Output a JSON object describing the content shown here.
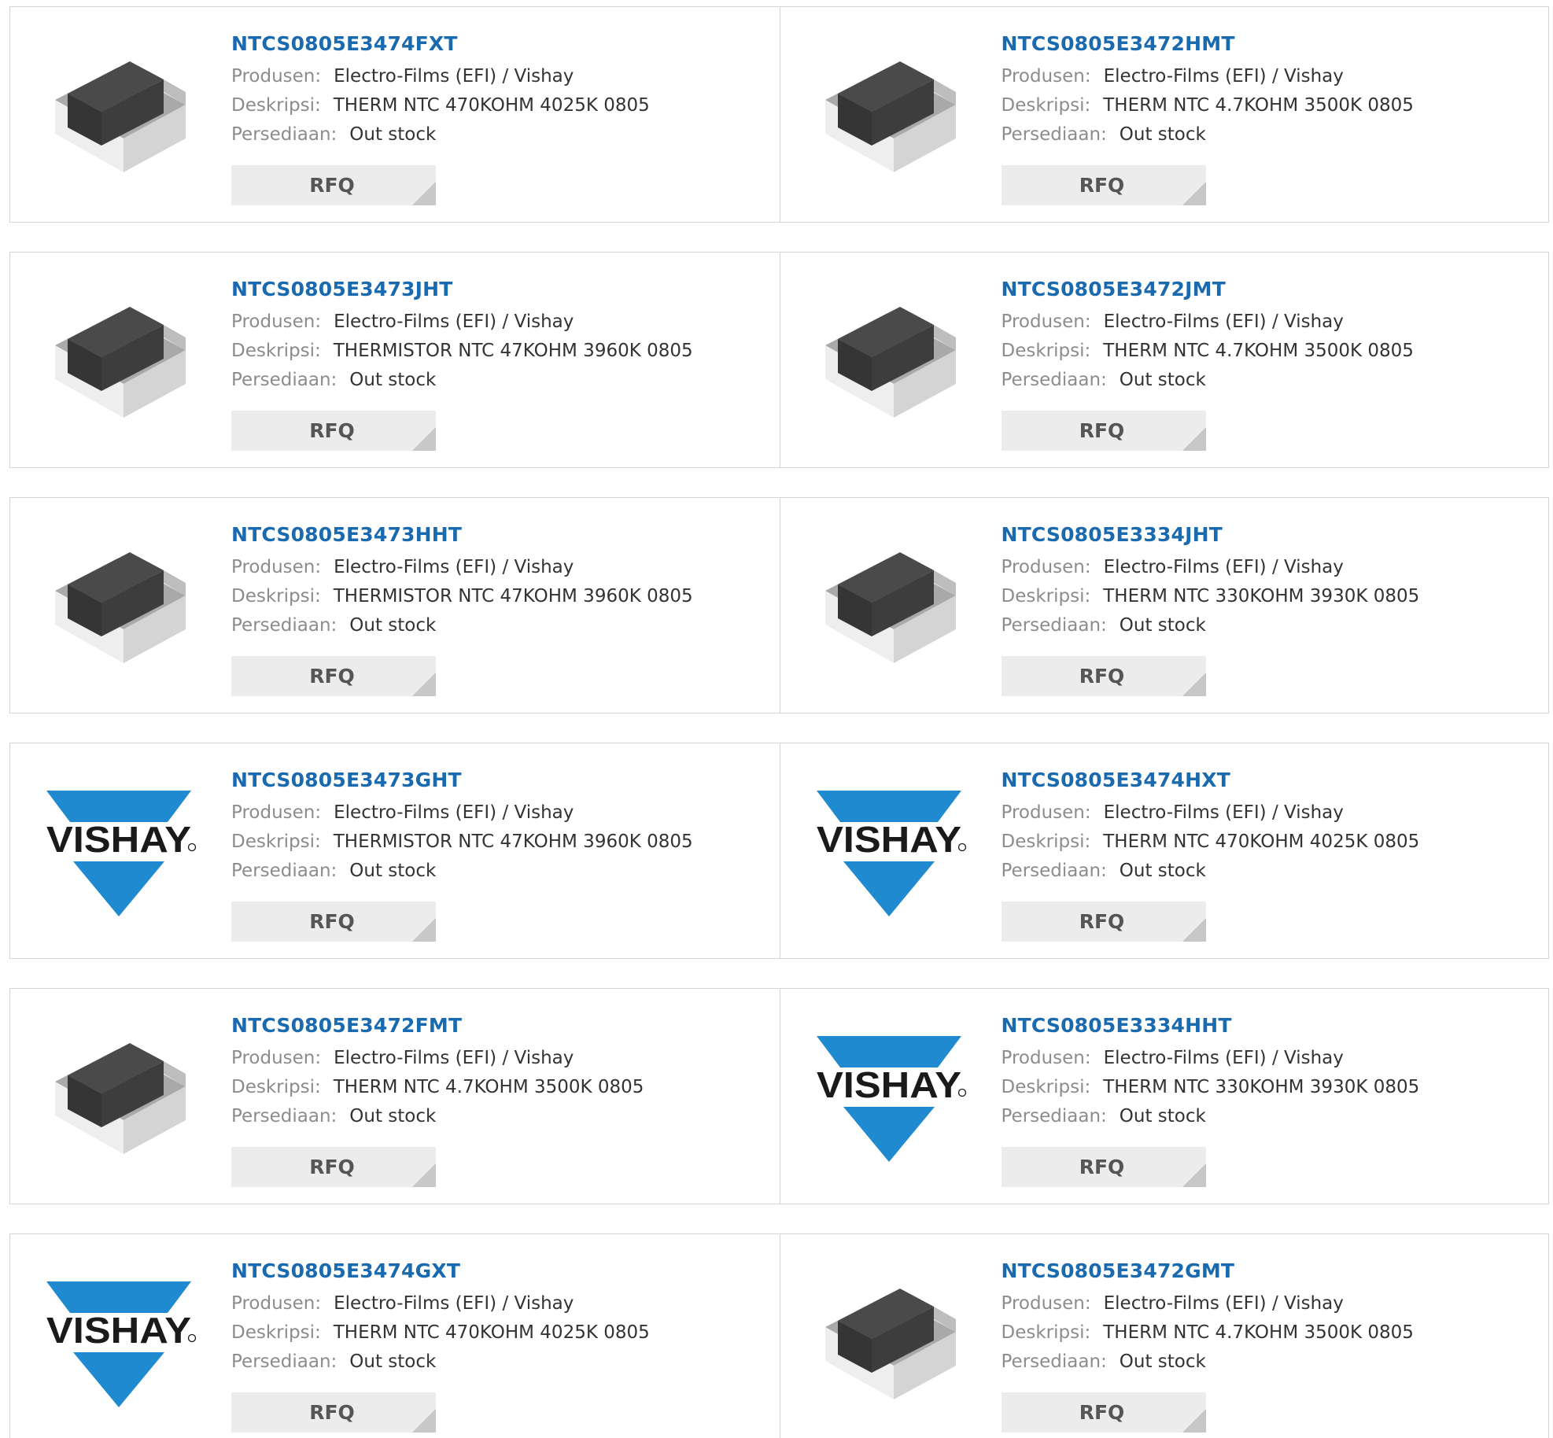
{
  "labels": {
    "manufacturer": "Produsen:",
    "description": "Deskripsi:",
    "stock": "Persediaan:",
    "rfq": "RFQ"
  },
  "colors": {
    "part_link": "#1a6ab0",
    "label": "#8c8c8c",
    "value": "#333333",
    "rfq_bg": "#ececec",
    "border": "#d4d4d4",
    "vishay_blue": "#1f8ad0"
  },
  "logo_text": "VISHAY",
  "products": [
    {
      "part": "NTCS0805E3474FXT",
      "manufacturer": "Electro-Films (EFI) / Vishay",
      "description": "THERM NTC 470KOHM 4025K 0805",
      "stock": "Out stock",
      "image": "chip-component"
    },
    {
      "part": "NTCS0805E3472HMT",
      "manufacturer": "Electro-Films (EFI) / Vishay",
      "description": "THERM NTC 4.7KOHM 3500K 0805",
      "stock": "Out stock",
      "image": "chip-component"
    },
    {
      "part": "NTCS0805E3473JHT",
      "manufacturer": "Electro-Films (EFI) / Vishay",
      "description": "THERMISTOR NTC 47KOHM 3960K 0805",
      "stock": "Out stock",
      "image": "chip-component"
    },
    {
      "part": "NTCS0805E3472JMT",
      "manufacturer": "Electro-Films (EFI) / Vishay",
      "description": "THERM NTC 4.7KOHM 3500K 0805",
      "stock": "Out stock",
      "image": "chip-component"
    },
    {
      "part": "NTCS0805E3473HHT",
      "manufacturer": "Electro-Films (EFI) / Vishay",
      "description": "THERMISTOR NTC 47KOHM 3960K 0805",
      "stock": "Out stock",
      "image": "chip-component"
    },
    {
      "part": "NTCS0805E3334JHT",
      "manufacturer": "Electro-Films (EFI) / Vishay",
      "description": "THERM NTC 330KOHM 3930K 0805",
      "stock": "Out stock",
      "image": "chip-component"
    },
    {
      "part": "NTCS0805E3473GHT",
      "manufacturer": "Electro-Films (EFI) / Vishay",
      "description": "THERMISTOR NTC 47KOHM 3960K 0805",
      "stock": "Out stock",
      "image": "vishay-logo"
    },
    {
      "part": "NTCS0805E3474HXT",
      "manufacturer": "Electro-Films (EFI) / Vishay",
      "description": "THERM NTC 470KOHM 4025K 0805",
      "stock": "Out stock",
      "image": "vishay-logo"
    },
    {
      "part": "NTCS0805E3472FMT",
      "manufacturer": "Electro-Films (EFI) / Vishay",
      "description": "THERM NTC 4.7KOHM 3500K 0805",
      "stock": "Out stock",
      "image": "chip-component"
    },
    {
      "part": "NTCS0805E3334HHT",
      "manufacturer": "Electro-Films (EFI) / Vishay",
      "description": "THERM NTC 330KOHM 3930K 0805",
      "stock": "Out stock",
      "image": "vishay-logo"
    },
    {
      "part": "NTCS0805E3474GXT",
      "manufacturer": "Electro-Films (EFI) / Vishay",
      "description": "THERM NTC 470KOHM 4025K 0805",
      "stock": "Out stock",
      "image": "vishay-logo"
    },
    {
      "part": "NTCS0805E3472GMT",
      "manufacturer": "Electro-Films (EFI) / Vishay",
      "description": "THERM NTC 4.7KOHM 3500K 0805",
      "stock": "Out stock",
      "image": "chip-component"
    }
  ]
}
